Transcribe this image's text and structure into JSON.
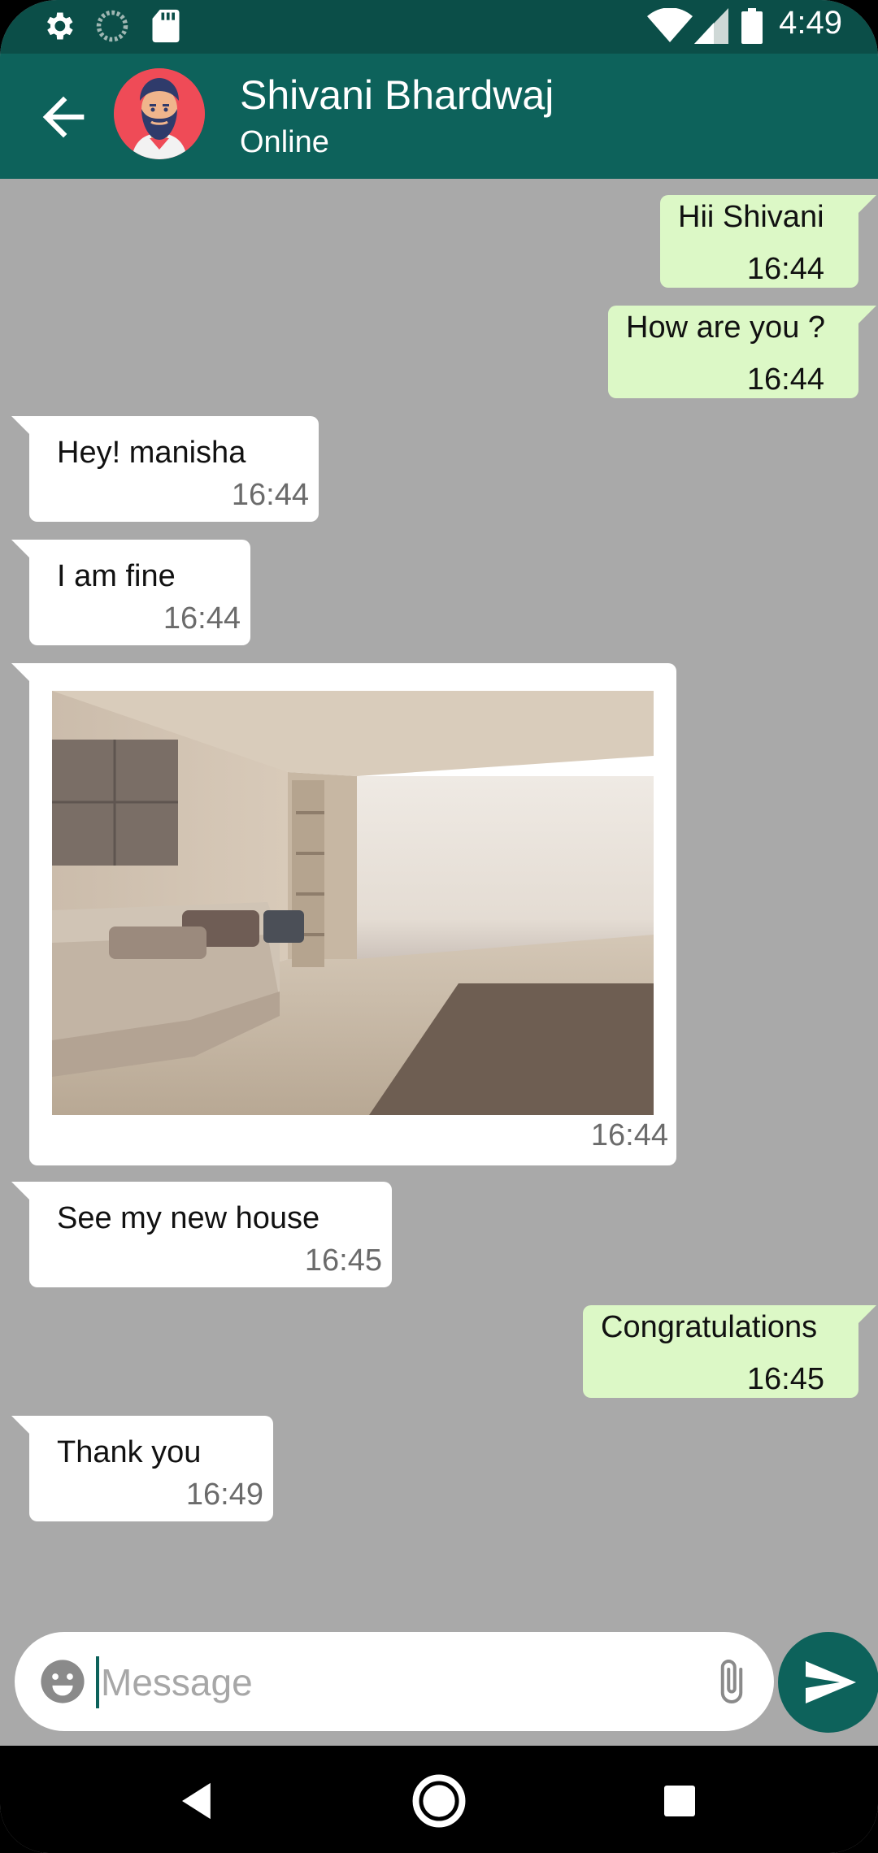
{
  "status_bar": {
    "time": "4:49",
    "left_icons": [
      "gear-icon",
      "loading-circle-icon",
      "sd-card-icon"
    ],
    "right_icons": [
      "wifi-icon",
      "cell-signal-icon",
      "battery-icon"
    ]
  },
  "header": {
    "contact_name": "Shivani Bhardwaj",
    "status": "Online",
    "back_icon": "arrow-left-icon"
  },
  "messages": [
    {
      "direction": "out",
      "text": "Hii Shivani",
      "time": "16:44"
    },
    {
      "direction": "out",
      "text": "How are you ?",
      "time": "16:44"
    },
    {
      "direction": "in",
      "text": "Hey! manisha",
      "time": "16:44"
    },
    {
      "direction": "in",
      "text": "I am fine",
      "time": "16:44"
    },
    {
      "direction": "in",
      "type": "image",
      "image": "living-room-photo",
      "time": "16:44"
    },
    {
      "direction": "in",
      "text": "See my new house",
      "time": "16:45"
    },
    {
      "direction": "out",
      "text": "Congratulations",
      "time": "16:45"
    },
    {
      "direction": "in",
      "text": "Thank you",
      "time": "16:49"
    }
  ],
  "composer": {
    "placeholder": "Message",
    "emoji_icon": "emoji-icon",
    "attach_icon": "paperclip-icon",
    "send_icon": "send-icon"
  },
  "colors": {
    "header": "#0d625b",
    "status_bar": "#0b4e48",
    "chat_background": "#a9a9a9",
    "outgoing_bubble": "#dcf8c6",
    "incoming_bubble": "#ffffff"
  }
}
